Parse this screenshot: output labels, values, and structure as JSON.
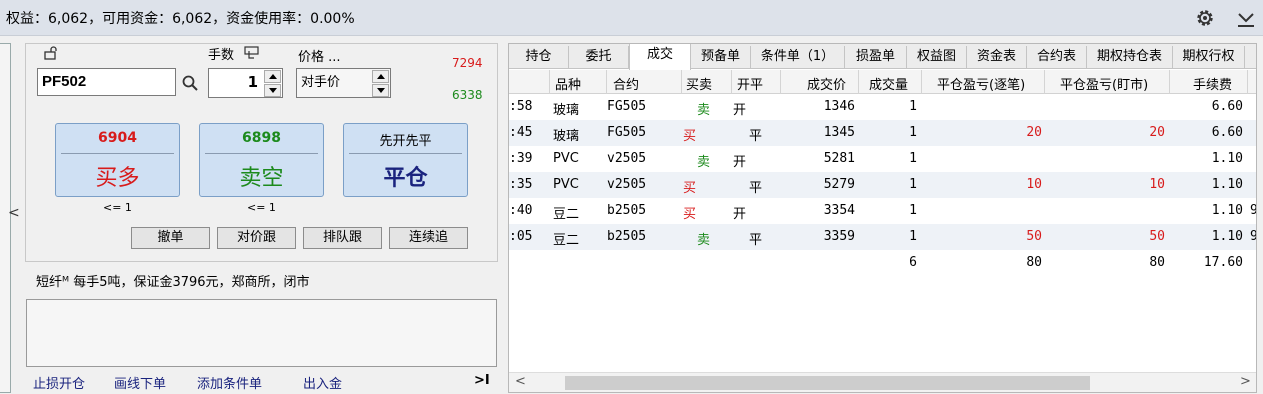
{
  "topbar": {
    "summary": "权益：6,062，可用资金：6,062，资金使用率：0.00%",
    "icons": [
      "gear-icon",
      "download-icon"
    ]
  },
  "order": {
    "contract": "PF502",
    "qty_label": "手数",
    "qty": "1",
    "price_label": "价格 ...",
    "price_mode": "对手价",
    "price_high": "7294",
    "price_low": "6338",
    "buy": {
      "price": "6904",
      "label": "买多",
      "limit": "<= 1"
    },
    "sell": {
      "price": "6898",
      "label": "卖空",
      "limit": "<= 1"
    },
    "close": {
      "mode": "先开先平",
      "label": "平仓"
    },
    "buttons": [
      "撤单",
      "对价跟",
      "排队跟",
      "连续追"
    ],
    "info": "短纤ᴹ 每手5吨，保证金3796元，郑商所，闭市",
    "links": [
      "止损开仓",
      "画线下单",
      "添加条件单",
      "出入金"
    ],
    "collapse_glyph": "<",
    "pin_glyph": ">I"
  },
  "tabs": [
    "持仓",
    "委托",
    "成交",
    "预备单",
    "条件单（1）",
    "损盈单",
    "权益图",
    "资金表",
    "合约表",
    "期权持仓表",
    "期权行权"
  ],
  "table": {
    "headers": [
      "",
      "品种",
      "合约",
      "买卖",
      "开平",
      "成交价",
      "成交量",
      "平仓盈亏(逐笔)",
      "平仓盈亏(盯市)",
      "手续费"
    ],
    "rows": [
      {
        "time": ":58",
        "kind": "玻璃",
        "code": "FG505",
        "side": "卖",
        "oc": "开",
        "price": "1346",
        "vol": "1",
        "pnl1": "",
        "pnl2": "",
        "fee": "6.60",
        "extra": ""
      },
      {
        "time": ":45",
        "kind": "玻璃",
        "code": "FG505",
        "side": "买",
        "oc": "平",
        "price": "1345",
        "vol": "1",
        "pnl1": "20",
        "pnl2": "20",
        "fee": "6.60",
        "extra": ""
      },
      {
        "time": ":39",
        "kind": "PVC",
        "code": "v2505",
        "side": "卖",
        "oc": "开",
        "price": "5281",
        "vol": "1",
        "pnl1": "",
        "pnl2": "",
        "fee": "1.10",
        "extra": ""
      },
      {
        "time": ":35",
        "kind": "PVC",
        "code": "v2505",
        "side": "买",
        "oc": "平",
        "price": "5279",
        "vol": "1",
        "pnl1": "10",
        "pnl2": "10",
        "fee": "1.10",
        "extra": ""
      },
      {
        "time": ":40",
        "kind": "豆二",
        "code": "b2505",
        "side": "买",
        "oc": "开",
        "price": "3354",
        "vol": "1",
        "pnl1": "",
        "pnl2": "",
        "fee": "1.10",
        "extra": "9"
      },
      {
        "time": ":05",
        "kind": "豆二",
        "code": "b2505",
        "side": "卖",
        "oc": "平",
        "price": "3359",
        "vol": "1",
        "pnl1": "50",
        "pnl2": "50",
        "fee": "1.10",
        "extra": "9"
      }
    ],
    "total": {
      "vol": "6",
      "pnl1": "80",
      "pnl2": "80",
      "fee": "17.60"
    }
  },
  "colors": {
    "buy": "#d81b1b",
    "sell": "#1c8a1c",
    "accent": "#cfe0f3"
  }
}
